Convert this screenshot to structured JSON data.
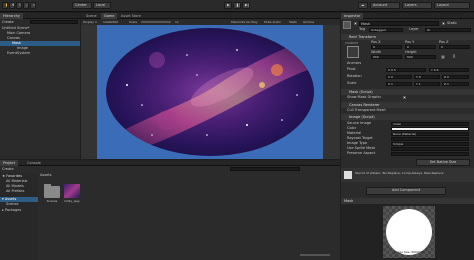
{
  "toolbar": {
    "buttons": [
      "Center",
      "Local"
    ],
    "account": "Account",
    "layers": "Layers",
    "layout": "Layout"
  },
  "hierarchy": {
    "tab": "Hierarchy",
    "create": "Create",
    "items": [
      {
        "label": "Untitled Scene*",
        "indent": 0
      },
      {
        "label": "Main Camera",
        "indent": 1
      },
      {
        "label": "Canvas",
        "indent": 1
      },
      {
        "label": "Mask",
        "indent": 2
      },
      {
        "label": "Image",
        "indent": 3
      },
      {
        "label": "EventSystem",
        "indent": 1
      }
    ],
    "selected_index": 3
  },
  "center_tabs": [
    "Scene",
    "Game",
    "Asset Store"
  ],
  "game_toolbar": [
    "Display 1",
    "1440x900",
    "Scale",
    "1x",
    "Maximize On Play",
    "Mute Audio",
    "Stats",
    "Gizmos"
  ],
  "inspector": {
    "tab": "Inspector",
    "object_name": "Mask",
    "static": "Static",
    "tag_label": "Tag",
    "tag_value": "Untagged",
    "layer_label": "Layer",
    "layer_value": "UI",
    "rect_transform": {
      "title": "Rect Transform",
      "preset": "custom",
      "pos_labels": [
        "Pos X",
        "Pos Y",
        "Pos Z"
      ],
      "pos_values": [
        "0",
        "0",
        "0"
      ],
      "size_labels": [
        "Width",
        "Height"
      ],
      "size_values": [
        "600",
        "600"
      ],
      "anchors": "Anchors",
      "pivot": "Pivot",
      "pivot_values": [
        "X 0.5",
        "Y 0.5"
      ],
      "rotation": "Rotation",
      "rotation_values": [
        "X 0",
        "Y 0",
        "Z 0"
      ],
      "scale": "Scale",
      "scale_values": [
        "X 1",
        "Y 1",
        "Z 1"
      ]
    },
    "mask": {
      "title": "Mask (Script)",
      "show_mask_graphic": "Show Mask Graphic"
    },
    "canvas_renderer": {
      "title": "Canvas Renderer",
      "cull": "Cull Transparent Mesh"
    },
    "image": {
      "title": "Image (Script)",
      "fields": [
        {
          "label": "Source Image",
          "value": "mask"
        },
        {
          "label": "Color",
          "value": ""
        },
        {
          "label": "Material",
          "value": "None (Material)"
        },
        {
          "label": "Raycast Target",
          "value": ""
        },
        {
          "label": "Image Type",
          "value": "Simple"
        },
        {
          "label": "Use Sprite Mesh",
          "value": ""
        },
        {
          "label": "Preserve Aspect",
          "value": ""
        }
      ],
      "native_button": "Set Native Size"
    },
    "material_info": "Stencil UI (Mask), Tex:Replace, Comp:Always, Pass:Replace",
    "add_component": "Add Component",
    "preview_title": "Mask",
    "preview_caption": "Image Size: 600x600"
  },
  "project": {
    "tabs": [
      "Project",
      "Console"
    ],
    "create": "Create",
    "favorites": {
      "title": "Favorites",
      "items": [
        "All Materials",
        "All Models",
        "All Prefabs"
      ]
    },
    "assets_root": {
      "title": "Assets",
      "items": [
        "Scenes"
      ]
    },
    "packages": "Packages",
    "breadcrumb": "Assets",
    "assets": [
      {
        "name": "Scenes",
        "kind": "folder"
      },
      {
        "name": "milky_way",
        "kind": "image"
      }
    ]
  },
  "colors": {
    "accent": "#2c5d87",
    "game_bg": "#3b6cb7"
  }
}
